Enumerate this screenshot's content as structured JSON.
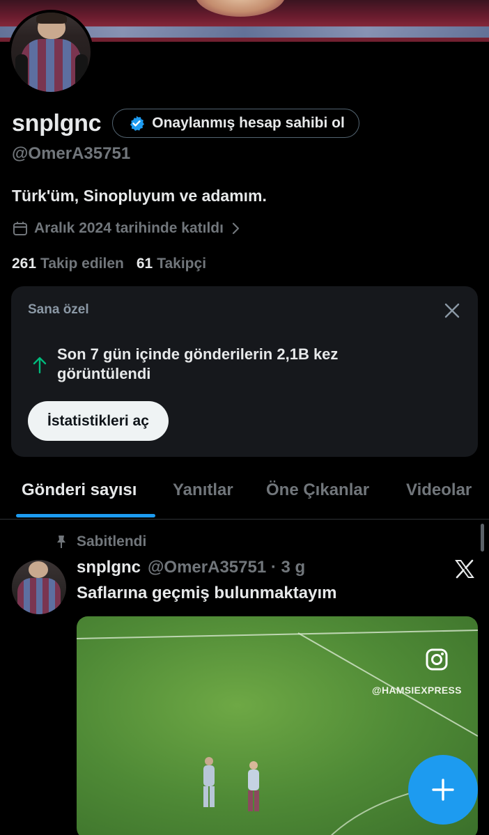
{
  "profile": {
    "display_name": "snplgnc",
    "verify_cta": "Onaylanmış hesap sahibi ol",
    "handle": "@OmerA35751",
    "bio": "Türk'üm, Sinopluyum ve adamım.",
    "joined": "Aralık 2024 tarihinde katıldı",
    "following_count": "261",
    "following_label": "Takip edilen",
    "followers_count": "61",
    "followers_label": "Takipçi"
  },
  "insight_card": {
    "title": "Sana özel",
    "message": "Son 7 gün içinde gönderilerin 2,1B kez görüntülendi",
    "button_label": "İstatistikleri aç"
  },
  "tabs": [
    {
      "label": "Gönderi sayısı",
      "active": true
    },
    {
      "label": "Yanıtlar",
      "active": false
    },
    {
      "label": "Öne Çıkanlar",
      "active": false
    },
    {
      "label": "Videolar",
      "active": false
    }
  ],
  "post": {
    "pinned_label": "Sabitlendi",
    "author_name": "snplgnc",
    "author_meta": "@OmerA35751 · 3 g",
    "text": "Saflarına geçmiş bulunmaktayım",
    "media_watermark": "@HAMSIEXPRESS"
  },
  "colors": {
    "accent": "#1d9bf0",
    "muted_text": "#71767b",
    "card_bg": "#16181c",
    "background": "#000000"
  },
  "icons": [
    "verified-badge-icon",
    "calendar-icon",
    "chevron-right-icon",
    "close-icon",
    "arrow-up-icon",
    "pin-icon",
    "x-logo-icon",
    "instagram-icon",
    "plus-icon"
  ]
}
